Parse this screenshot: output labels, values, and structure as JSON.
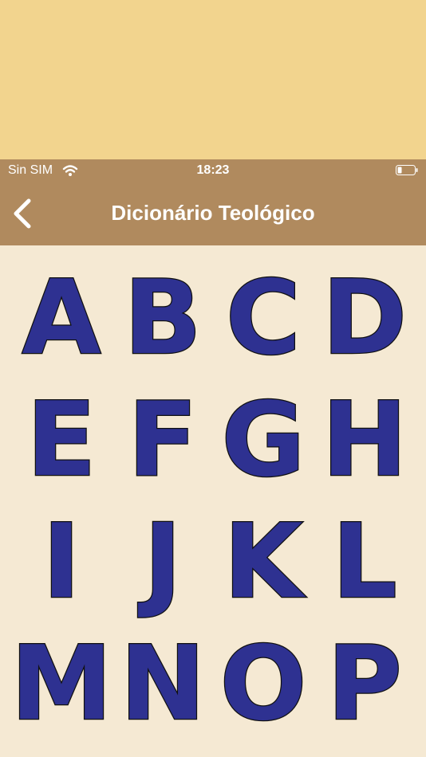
{
  "status_bar": {
    "carrier": "Sin SIM",
    "time": "18:23",
    "icons": [
      "wifi-icon",
      "battery-icon"
    ]
  },
  "nav": {
    "back_icon": "chevron-left-icon",
    "title": "Dicionário Teológico"
  },
  "colors": {
    "top_band": "#f2d48e",
    "bar": "#b08a5e",
    "background": "#f5e9d3",
    "letter_fill": "#2e3191",
    "letter_outline": "#111111"
  },
  "letters": [
    "A",
    "B",
    "C",
    "D",
    "E",
    "F",
    "G",
    "H",
    "I",
    "J",
    "K",
    "L",
    "M",
    "N",
    "O",
    "P"
  ]
}
